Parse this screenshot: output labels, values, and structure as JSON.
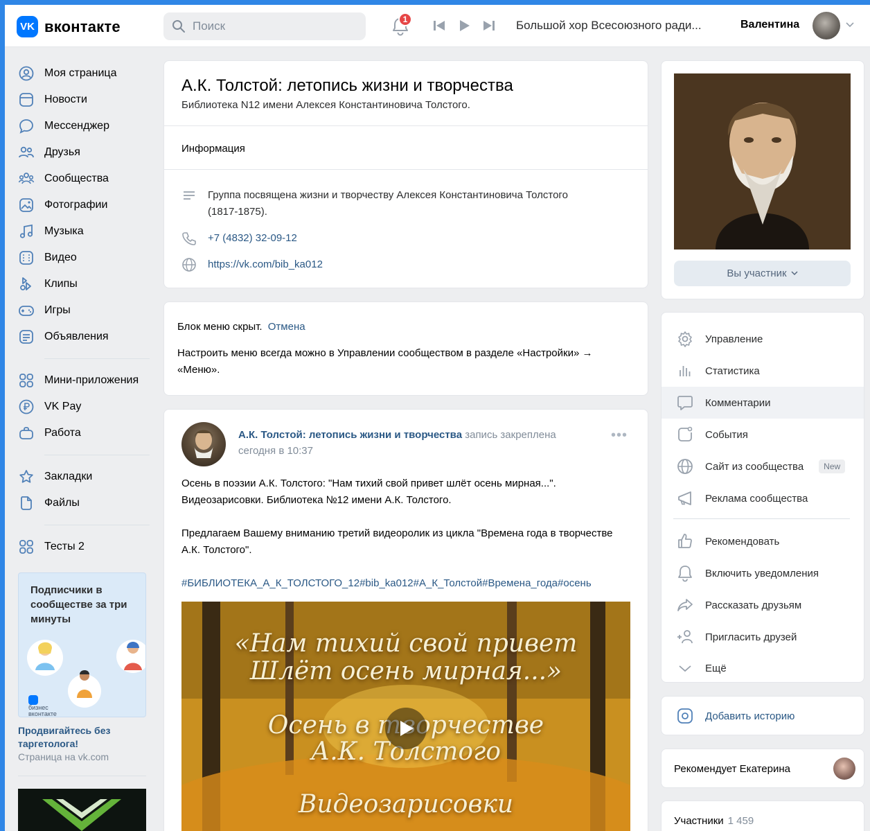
{
  "header": {
    "logo_text": "вконтакте",
    "logo_mark": "VK",
    "search_placeholder": "Поиск",
    "notification_count": "1",
    "track_title": "Большой хор Всесоюзного ради...",
    "user_name": "Валентина"
  },
  "nav": {
    "items": [
      {
        "label": "Моя страница",
        "icon": "user-circle-icon"
      },
      {
        "label": "Новости",
        "icon": "news-icon"
      },
      {
        "label": "Мессенджер",
        "icon": "chat-icon"
      },
      {
        "label": "Друзья",
        "icon": "friends-icon"
      },
      {
        "label": "Сообщества",
        "icon": "communities-icon"
      },
      {
        "label": "Фотографии",
        "icon": "photo-icon"
      },
      {
        "label": "Музыка",
        "icon": "music-icon"
      },
      {
        "label": "Видео",
        "icon": "video-icon"
      },
      {
        "label": "Клипы",
        "icon": "clips-icon"
      },
      {
        "label": "Игры",
        "icon": "gamepad-icon"
      },
      {
        "label": "Объявления",
        "icon": "classifieds-icon"
      }
    ],
    "items2": [
      {
        "label": "Мини-приложения",
        "icon": "apps-icon"
      },
      {
        "label": "VK Pay",
        "icon": "vkpay-icon"
      },
      {
        "label": "Работа",
        "icon": "briefcase-icon"
      }
    ],
    "items3": [
      {
        "label": "Закладки",
        "icon": "star-icon"
      },
      {
        "label": "Файлы",
        "icon": "file-icon"
      }
    ],
    "items4": [
      {
        "label": "Тесты 2",
        "icon": "apps-icon"
      }
    ]
  },
  "promo": {
    "title": "Подписчики в сообществе за три минуты",
    "logo_line1": "бизнес",
    "logo_line2": "вконтакте",
    "link": "Продвигайтесь без таргетолога!",
    "sub": "Страница на vk.com"
  },
  "group": {
    "title": "А.К. Толстой: летопись жизни и творчества",
    "subtitle": "Библиотека N12 имени Алексея Константиновича Толстого.",
    "info_heading": "Информация",
    "description": "Группа посвящена жизни и творчеству Алексея Константиновича Толстого (1817-1875).",
    "phone": "+7 (4832) 32-09-12",
    "site": "https://vk.com/bib_ka012"
  },
  "menu_notice": {
    "text": "Блок меню скрыт.",
    "cancel": "Отмена",
    "hint": "Настроить меню всегда можно в Управлении сообществом в разделе «Настройки» → «Меню»."
  },
  "post": {
    "author": "А.К. Толстой: летопись жизни и творчества",
    "pinned": "запись закреплена",
    "time": "сегодня в 10:37",
    "more": "•••",
    "paragraph1": "Осень в поэзии А.К. Толстого: \"Нам тихий свой привет шлёт осень мирная...\". Видеозарисовки. Библиотека №12 имени А.К. Толстого.",
    "paragraph2": "Предлагаем Вашему вниманию третий видеоролик из цикла \"Времена года в творчестве А.К. Толстого\".",
    "tags": "#БИБЛИОТЕКА_А_К_ТОЛСТОГО_12#bib_ka012#А_К_Толстой#Времена_года#осень",
    "video_line1": "«Нам тихий свой привет",
    "video_line2": "Шлёт осень мирная...»",
    "video_line3": "Осень в творчестве",
    "video_line4": "А.К. Толстого",
    "video_line5": "Видеозарисовки"
  },
  "cover": {
    "member_button": "Вы участник"
  },
  "actions": [
    {
      "label": "Управление",
      "icon": "gear-icon"
    },
    {
      "label": "Статистика",
      "icon": "stats-icon"
    },
    {
      "label": "Комментарии",
      "icon": "comment-icon"
    },
    {
      "label": "События",
      "icon": "events-icon"
    },
    {
      "label": "Сайт из сообщества",
      "icon": "globe-icon",
      "badge": "New"
    },
    {
      "label": "Реклама сообщества",
      "icon": "megaphone-icon"
    },
    {
      "label": "Рекомендовать",
      "icon": "thumb-up-icon"
    },
    {
      "label": "Включить уведомления",
      "icon": "bell-icon"
    },
    {
      "label": "Рассказать друзьям",
      "icon": "share-icon"
    },
    {
      "label": "Пригласить друзей",
      "icon": "add-user-icon"
    },
    {
      "label": "Ещё",
      "icon": "chevron-down-icon"
    }
  ],
  "story": {
    "label": "Добавить историю"
  },
  "recommend": {
    "label": "Рекомендует Екатерина"
  },
  "members": {
    "label": "Участники",
    "count": "1 459"
  },
  "colors": {
    "accent": "#0077ff",
    "link": "#2a5885",
    "badge": "#e64646",
    "background": "#edeef0"
  }
}
